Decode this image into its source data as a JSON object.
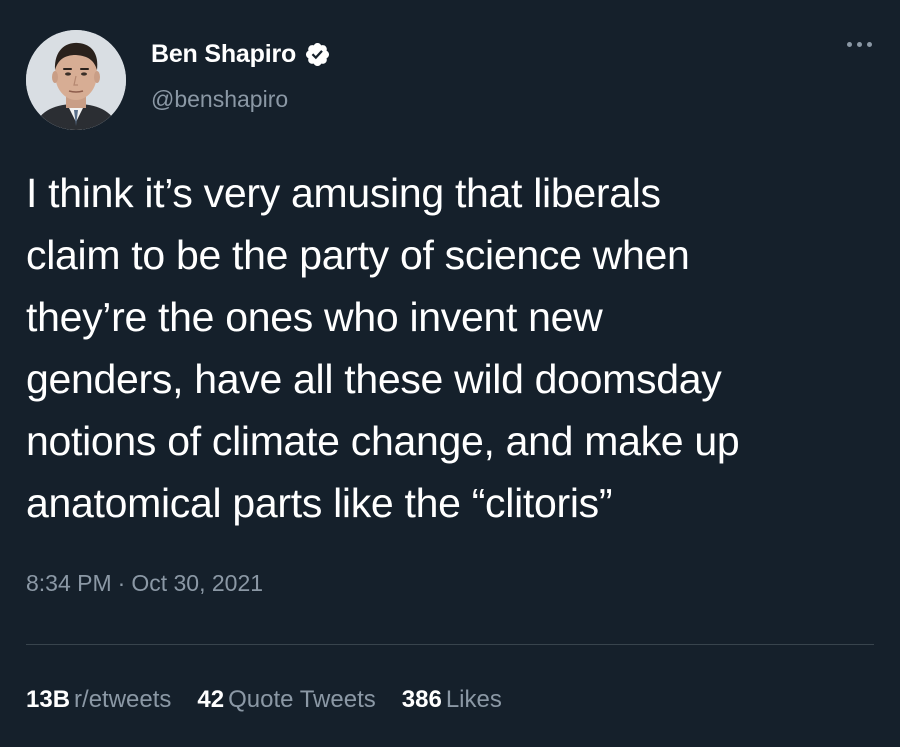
{
  "author": {
    "display_name": "Ben Shapiro",
    "handle": "@benshapiro",
    "verified": true,
    "verified_icon": "verified-badge-icon"
  },
  "tweet": {
    "lines": [
      "I think it’s very amusing that liberals",
      "claim to be the party of science when",
      "they’re the ones who invent new",
      "genders, have all these wild doomsday",
      "notions of climate change, and make up",
      "anatomical parts like the “clitoris”"
    ],
    "time": "8:34 PM",
    "separator": "·",
    "date": "Oct 30, 2021"
  },
  "stats": {
    "retweets": {
      "value": "13B",
      "label": "r/etweets"
    },
    "quotes": {
      "value": "42",
      "label": "Quote Tweets"
    },
    "likes": {
      "value": "386",
      "label": "Likes"
    }
  },
  "colors": {
    "background": "#15202b",
    "text": "#ffffff",
    "secondary": "#8b98a5",
    "divider": "#38444d"
  }
}
